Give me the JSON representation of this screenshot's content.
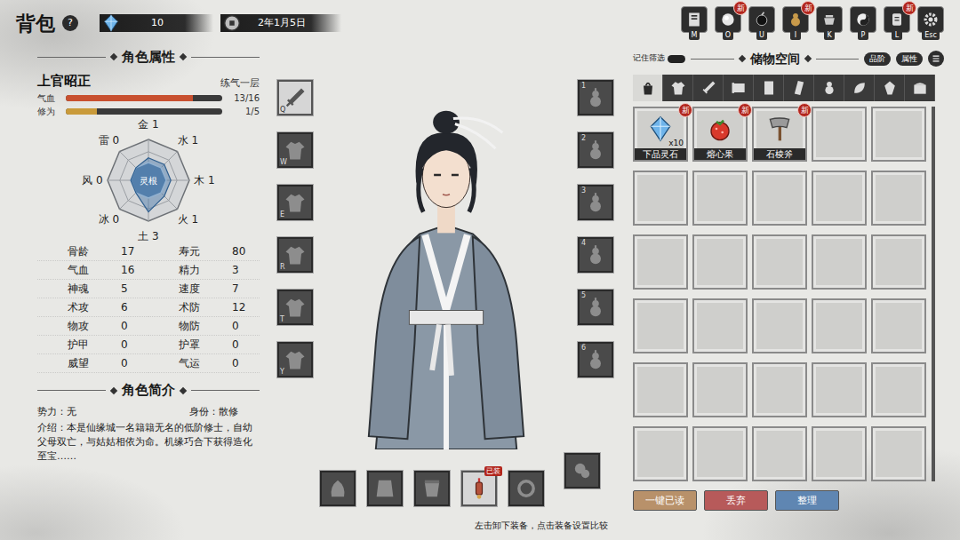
{
  "header": {
    "title": "背包",
    "help": "?",
    "spirit_stones": "10",
    "date": "2年1月5日"
  },
  "new_label": "新",
  "menu": [
    {
      "key": "M",
      "new": false
    },
    {
      "key": "O",
      "new": true
    },
    {
      "key": "U",
      "new": false
    },
    {
      "key": "I",
      "new": true
    },
    {
      "key": "K",
      "new": false
    },
    {
      "key": "P",
      "new": false
    },
    {
      "key": "L",
      "new": true
    },
    {
      "key": "Esc",
      "new": false
    }
  ],
  "attributes": {
    "title": "角色属性",
    "name": "上官昭正",
    "realm": "练气一层",
    "bars": [
      {
        "label": "气血",
        "reading": "13/16",
        "level": 0.8125,
        "color": "#c8502f"
      },
      {
        "label": "修为",
        "reading": "1/5",
        "level": 0.2,
        "color": "#c99a3a"
      }
    ],
    "root_label": "灵根",
    "elements": [
      {
        "name": "金",
        "value": "1"
      },
      {
        "name": "水",
        "value": "1"
      },
      {
        "name": "木",
        "value": "1"
      },
      {
        "name": "火",
        "value": "1"
      },
      {
        "name": "土",
        "value": "3"
      },
      {
        "name": "冰",
        "value": "0"
      },
      {
        "name": "风",
        "value": "0"
      },
      {
        "name": "雷",
        "value": "0"
      }
    ],
    "stats": [
      {
        "label": "骨龄",
        "value": "17"
      },
      {
        "label": "寿元",
        "value": "80"
      },
      {
        "label": "气血",
        "value": "16"
      },
      {
        "label": "精力",
        "value": "3"
      },
      {
        "label": "神魂",
        "value": "5"
      },
      {
        "label": "速度",
        "value": "7"
      },
      {
        "label": "术攻",
        "value": "6"
      },
      {
        "label": "术防",
        "value": "12"
      },
      {
        "label": "物攻",
        "value": "0"
      },
      {
        "label": "物防",
        "value": "0"
      },
      {
        "label": "护甲",
        "value": "0"
      },
      {
        "label": "护罩",
        "value": "0"
      },
      {
        "label": "威望",
        "value": "0"
      },
      {
        "label": "气运",
        "value": "0"
      }
    ]
  },
  "profile": {
    "title": "角色简介",
    "faction": "势力：无",
    "identity": "身份：散修",
    "intro": "介绍：本是仙缘城一名籍籍无名的低阶修士，自幼父母双亡，与姑姑相依为命。机缘巧合下获得造化至宝……"
  },
  "equipment": {
    "left": [
      {
        "key": "Q"
      },
      {
        "key": "W"
      },
      {
        "key": "E"
      },
      {
        "key": "R"
      },
      {
        "key": "T"
      },
      {
        "key": "Y"
      }
    ],
    "right": [
      {
        "key": "1"
      },
      {
        "key": "2"
      },
      {
        "key": "3"
      },
      {
        "key": "4"
      },
      {
        "key": "5"
      },
      {
        "key": "6"
      }
    ],
    "bottom": [
      {
        "kind": "empty"
      },
      {
        "kind": "empty"
      },
      {
        "kind": "empty"
      },
      {
        "kind": "item",
        "tag": "已装"
      },
      {
        "kind": "empty"
      },
      {
        "kind": "empty"
      }
    ],
    "hint": "左击卸下装备，点击装备设置比较"
  },
  "storage": {
    "title": "储物空间",
    "filter_label": "记住筛选",
    "filter_on": true,
    "sort_buttons": [
      "品阶",
      "属性"
    ],
    "tabs": [
      {
        "kind": "all",
        "selected": true
      },
      {
        "kind": "clothes",
        "selected": false
      },
      {
        "kind": "weapon",
        "selected": false
      },
      {
        "kind": "scroll",
        "selected": false
      },
      {
        "kind": "book",
        "selected": false
      },
      {
        "kind": "talisman",
        "selected": false
      },
      {
        "kind": "pill",
        "selected": false
      },
      {
        "kind": "herb",
        "selected": false
      },
      {
        "kind": "ore",
        "selected": false
      },
      {
        "kind": "chest",
        "selected": false
      }
    ],
    "items": [
      {
        "kind": "stone",
        "name": "下品灵石",
        "count": "x10",
        "new": true
      },
      {
        "kind": "fruit",
        "name": "熔心果",
        "new": true
      },
      {
        "kind": "tool",
        "name": "石棱斧",
        "new": true
      },
      {
        "kind": "empty"
      },
      {
        "kind": "empty"
      },
      {
        "kind": "empty"
      },
      {
        "kind": "empty"
      },
      {
        "kind": "empty"
      },
      {
        "kind": "empty"
      },
      {
        "kind": "empty"
      },
      {
        "kind": "empty"
      },
      {
        "kind": "empty"
      },
      {
        "kind": "empty"
      },
      {
        "kind": "empty"
      },
      {
        "kind": "empty"
      },
      {
        "kind": "empty"
      },
      {
        "kind": "empty"
      },
      {
        "kind": "empty"
      },
      {
        "kind": "empty"
      },
      {
        "kind": "empty"
      },
      {
        "kind": "empty"
      },
      {
        "kind": "empty"
      },
      {
        "kind": "empty"
      },
      {
        "kind": "empty"
      },
      {
        "kind": "empty"
      },
      {
        "kind": "empty"
      },
      {
        "kind": "empty"
      },
      {
        "kind": "empty"
      },
      {
        "kind": "empty"
      },
      {
        "kind": "empty"
      }
    ],
    "scroll_level": 1,
    "actions": [
      {
        "label": "一键已读",
        "color": "#b8916a"
      },
      {
        "label": "丢弃",
        "color": "#b75a5a"
      },
      {
        "label": "整理",
        "color": "#5f86b2"
      }
    ]
  }
}
